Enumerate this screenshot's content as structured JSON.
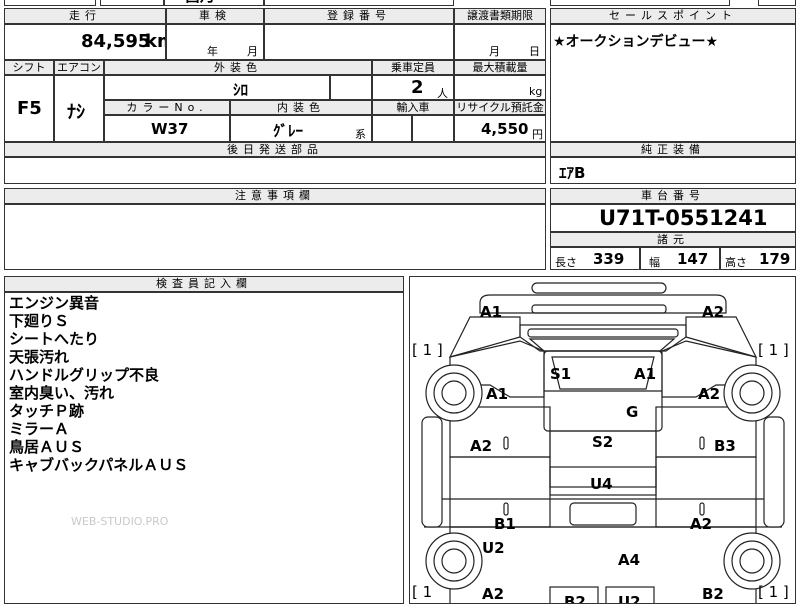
{
  "top_strip": {
    "fragment_1": "昌月",
    "fragment_2": "¨"
  },
  "mileage": {
    "header": "走行",
    "value": "84,595",
    "unit": "km"
  },
  "inspection": {
    "header": "車検",
    "year_unit": "年",
    "month_unit": "月"
  },
  "registration": {
    "header": "登録番号"
  },
  "transfer_deadline": {
    "header": "譲渡書類期限",
    "month_unit": "月",
    "day_unit": "日"
  },
  "sales_point": {
    "header": "セールスポイント",
    "text": "★オークションデビュー★"
  },
  "shift": {
    "header": "シフト",
    "value": "F5"
  },
  "aircon": {
    "header": "エアコン",
    "value": "ﾅｼ"
  },
  "exterior_color": {
    "header": "外装色",
    "value": "ｼﾛ"
  },
  "capacity": {
    "header": "乗車定員",
    "value": "2",
    "unit": "人"
  },
  "max_load": {
    "header": "最大積載量",
    "unit": "kg"
  },
  "color_no": {
    "header": "カラーNo.",
    "value": "W37"
  },
  "interior_color": {
    "header": "内装色",
    "value": "ｸﾞﾚｰ",
    "suffix": "系"
  },
  "import_car": {
    "header": "輸入車"
  },
  "recycle": {
    "header": "リサイクル預託金",
    "value": "4,550",
    "unit": "円"
  },
  "later_parts": {
    "header": "後日発送部品"
  },
  "genuine_equipment": {
    "header": "純正装備",
    "value": "ｴｱB"
  },
  "notes": {
    "header": "注意事項欄"
  },
  "chassis": {
    "header": "車台番号",
    "value": "U71T-0551241"
  },
  "specs": {
    "header": "諸元",
    "length_label": "長さ",
    "length_value": "339",
    "width_label": "幅",
    "width_value": "147",
    "height_label": "高さ",
    "height_value": "179"
  },
  "inspector": {
    "header": "検査員記入欄",
    "lines": [
      "エンジン異音",
      "下廻りＳ",
      "シートへたり",
      "天張汚れ",
      "ハンドルグリップ不良",
      "室内臭い、汚れ",
      "タッチＰ跡",
      "ミラーＡ",
      "鳥居ＡＵＳ",
      "キャブバックパネルＡＵＳ"
    ],
    "watermark": "WEB-STUDIO.PRO"
  },
  "diagram": {
    "labels": {
      "front_left_corner": "A1",
      "front_right_corner": "A2",
      "tire_fl": "[ 1 ]",
      "tire_fr": "[ 1 ]",
      "tire_rl": "[ 1",
      "tire_rr": "[ 1 ]",
      "seat": "S1",
      "windshield": "A1",
      "glass": "G",
      "left_door": "A1",
      "right_door": "A2",
      "left_panel": "A2",
      "right_panel": "B3",
      "floor": "S2",
      "cab_back": "U4",
      "left_step": "B1",
      "right_step": "A2",
      "left_rear": "U2",
      "bed": "A4",
      "rear_left": "A2",
      "rear_right": "B2",
      "rear_mid_1": "B2",
      "rear_mid_2": "U2"
    }
  }
}
